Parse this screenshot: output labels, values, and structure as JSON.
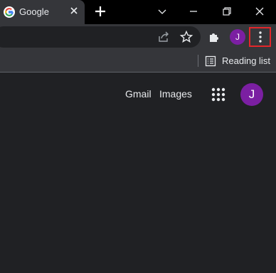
{
  "tab": {
    "title": "Google"
  },
  "toolbar": {
    "profile_initial": "J"
  },
  "bookmarks_bar": {
    "reading_list_label": "Reading list"
  },
  "page": {
    "gmail_label": "Gmail",
    "images_label": "Images",
    "account_initial": "J"
  },
  "colors": {
    "tabstrip_bg": "#000000",
    "toolbar_bg": "#35363a",
    "page_bg": "#202124",
    "avatar_purple": "#7b1fa2",
    "highlight_red": "#e3262a"
  },
  "icons": [
    "google-favicon",
    "close-icon",
    "plus-icon",
    "chevron-down-icon",
    "minimize-icon",
    "restore-icon",
    "window-close-icon",
    "share-icon",
    "star-icon",
    "extensions-icon",
    "more-vert-icon",
    "reading-list-icon",
    "apps-grid-icon"
  ]
}
